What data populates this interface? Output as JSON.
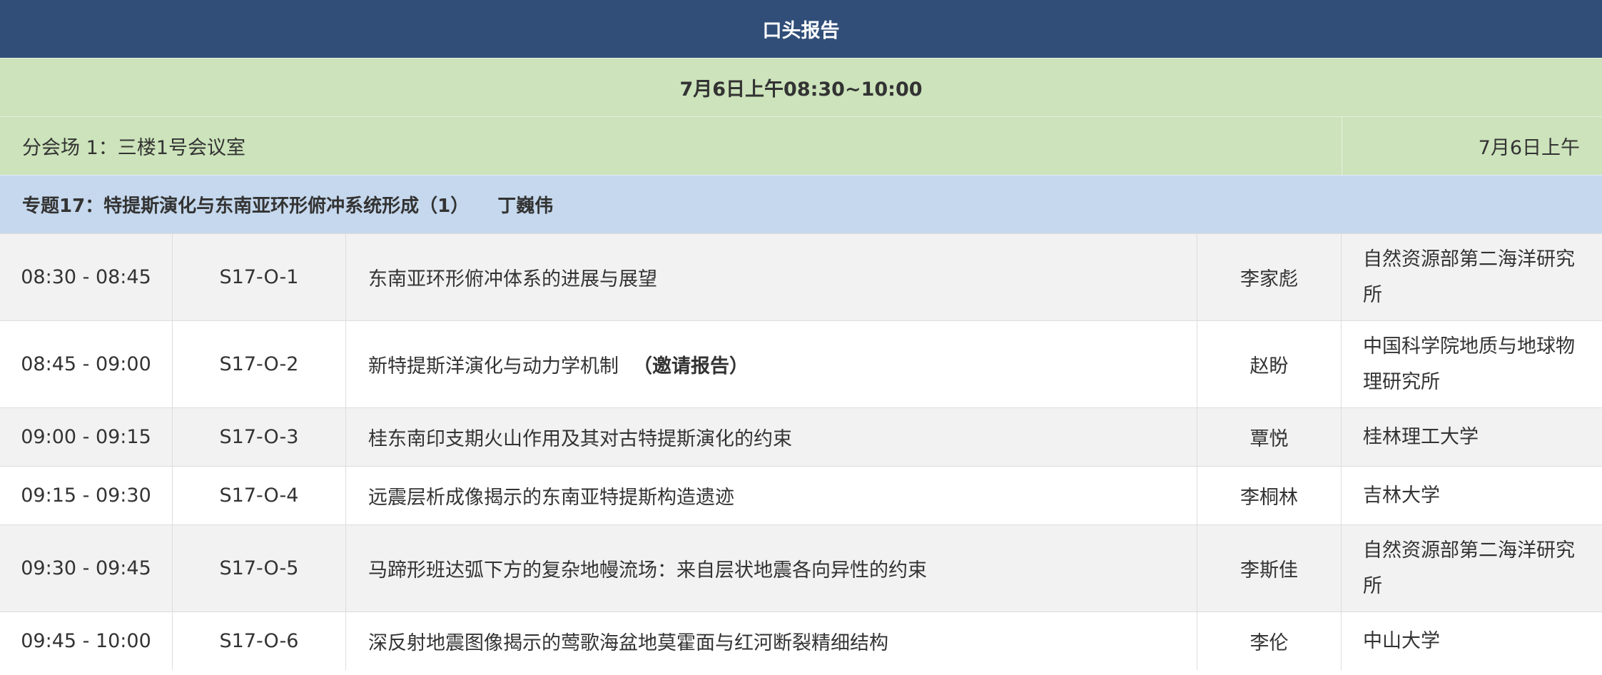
{
  "banner": {
    "title": "口头报告"
  },
  "session_date": "7月6日上午08:30~10:00",
  "venue": {
    "name": "分会场 1：三楼1号会议室",
    "date": "7月6日上午"
  },
  "topic": {
    "title": "专题17：特提斯演化与东南亚环形俯冲系统形成（1）",
    "chair": "丁巍伟"
  },
  "talks": [
    {
      "time": "08:30 - 08:45",
      "code": "S17-O-1",
      "title": "东南亚环形俯冲体系的进展与展望",
      "tag": "",
      "speaker": "李家彪",
      "institution": "自然资源部第二海洋研究所"
    },
    {
      "time": "08:45 - 09:00",
      "code": "S17-O-2",
      "title": "新特提斯洋演化与动力学机制",
      "tag": "（邀请报告）",
      "speaker": "赵盼",
      "institution": "中国科学院地质与地球物理研究所"
    },
    {
      "time": "09:00 - 09:15",
      "code": "S17-O-3",
      "title": "桂东南印支期火山作用及其对古特提斯演化的约束",
      "tag": "",
      "speaker": "覃悦",
      "institution": "桂林理工大学"
    },
    {
      "time": "09:15 - 09:30",
      "code": "S17-O-4",
      "title": "远震层析成像揭示的东南亚特提斯构造遗迹",
      "tag": "",
      "speaker": "李桐林",
      "institution": "吉林大学"
    },
    {
      "time": "09:30 - 09:45",
      "code": "S17-O-5",
      "title": "马蹄形班达弧下方的复杂地幔流场：来自层状地震各向异性的约束",
      "tag": "",
      "speaker": "李斯佳",
      "institution": "自然资源部第二海洋研究所"
    },
    {
      "time": "09:45 - 10:00",
      "code": "S17-O-6",
      "title": "深反射地震图像揭示的莺歌海盆地莫霍面与红河断裂精细结构",
      "tag": "",
      "speaker": "李伦",
      "institution": "中山大学"
    }
  ]
}
